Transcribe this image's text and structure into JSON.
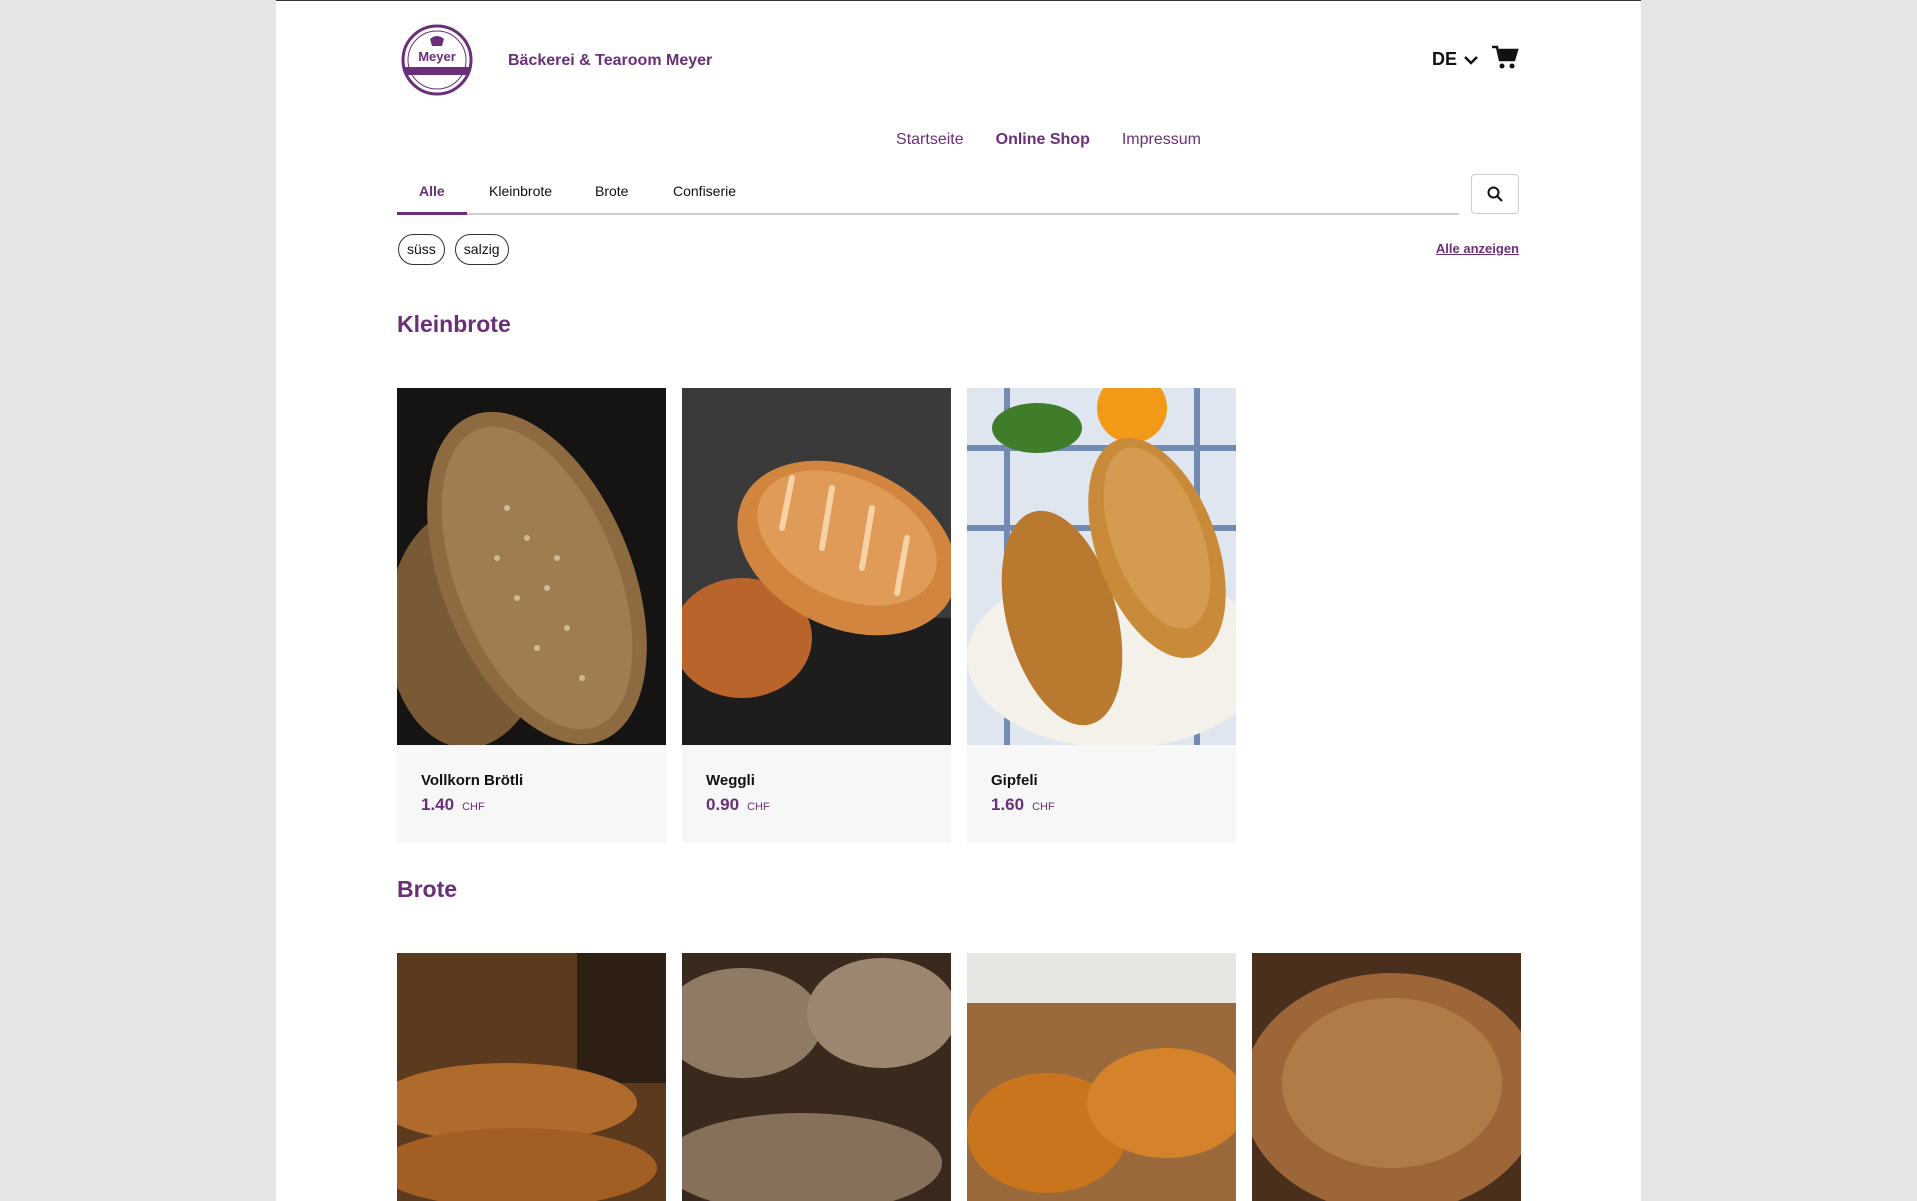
{
  "brand": {
    "name": "Bäckerei & Tearoom Meyer",
    "logo_text": "Meyer"
  },
  "header": {
    "language": "DE"
  },
  "main_nav": [
    {
      "label": "Startseite",
      "active": false
    },
    {
      "label": "Online Shop",
      "active": true
    },
    {
      "label": "Impressum",
      "active": false
    }
  ],
  "tabs": [
    {
      "label": "Alle",
      "active": true
    },
    {
      "label": "Kleinbrote",
      "active": false
    },
    {
      "label": "Brote",
      "active": false
    },
    {
      "label": "Confiserie",
      "active": false
    }
  ],
  "filters": {
    "chips": [
      "süss",
      "salzig"
    ],
    "show_all": "Alle anzeigen"
  },
  "sections": [
    {
      "title": "Kleinbrote",
      "products": [
        {
          "name": "Vollkorn Brötli",
          "price": "1.40",
          "currency": "CHF"
        },
        {
          "name": "Weggli",
          "price": "0.90",
          "currency": "CHF"
        },
        {
          "name": "Gipfeli",
          "price": "1.60",
          "currency": "CHF"
        }
      ]
    },
    {
      "title": "Brote",
      "products": [
        {},
        {},
        {},
        {}
      ]
    }
  ],
  "colors": {
    "accent": "#6b2f7a",
    "background": "#e5e5e5"
  }
}
